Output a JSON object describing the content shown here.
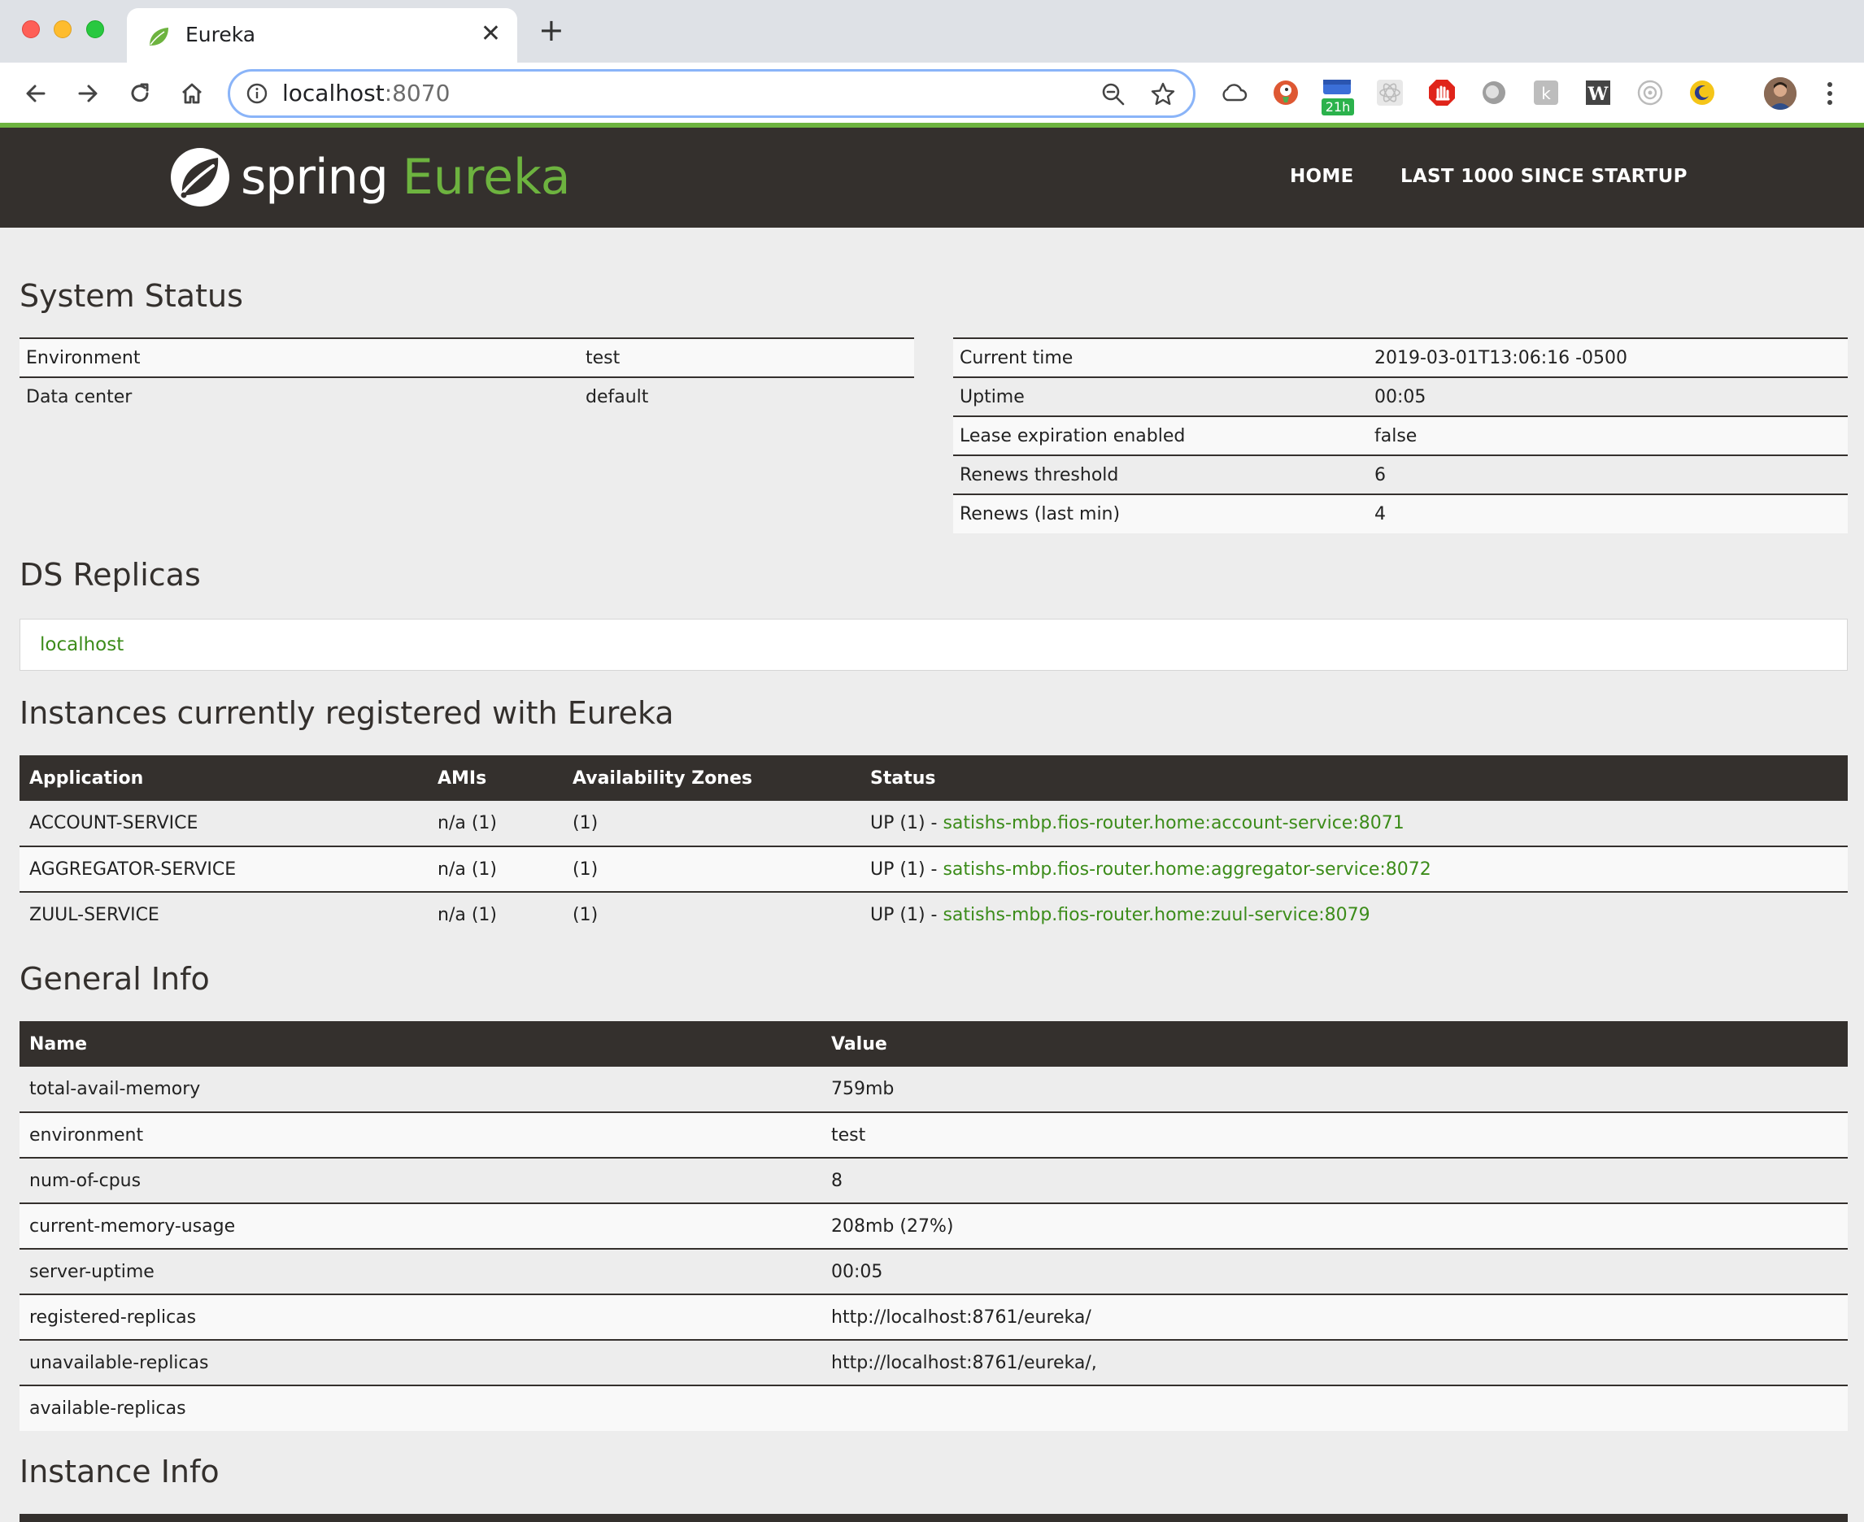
{
  "browser": {
    "tab_title": "Eureka",
    "url_host": "localhost",
    "url_port": ":8070",
    "badge_text": "21h"
  },
  "nav": {
    "logo_spring": "spring",
    "logo_eureka": "Eureka",
    "home": "HOME",
    "last1000": "LAST 1000 SINCE STARTUP"
  },
  "system_status": {
    "heading": "System Status",
    "left": [
      {
        "key": "Environment",
        "value": "test"
      },
      {
        "key": "Data center",
        "value": "default"
      }
    ],
    "right": [
      {
        "key": "Current time",
        "value": "2019-03-01T13:06:16 -0500"
      },
      {
        "key": "Uptime",
        "value": "00:05"
      },
      {
        "key": "Lease expiration enabled",
        "value": "false"
      },
      {
        "key": "Renews threshold",
        "value": "6"
      },
      {
        "key": "Renews (last min)",
        "value": "4"
      }
    ]
  },
  "ds_replicas": {
    "heading": "DS Replicas",
    "link": "localhost"
  },
  "instances": {
    "heading": "Instances currently registered with Eureka",
    "columns": [
      "Application",
      "AMIs",
      "Availability Zones",
      "Status"
    ],
    "rows": [
      {
        "app": "ACCOUNT-SERVICE",
        "amis": "n/a (1)",
        "zones": "(1)",
        "status": "UP (1) - ",
        "link": "satishs-mbp.fios-router.home:account-service:8071"
      },
      {
        "app": "AGGREGATOR-SERVICE",
        "amis": "n/a (1)",
        "zones": "(1)",
        "status": "UP (1) - ",
        "link": "satishs-mbp.fios-router.home:aggregator-service:8072"
      },
      {
        "app": "ZUUL-SERVICE",
        "amis": "n/a (1)",
        "zones": "(1)",
        "status": "UP (1) - ",
        "link": "satishs-mbp.fios-router.home:zuul-service:8079"
      }
    ]
  },
  "general_info": {
    "heading": "General Info",
    "columns": [
      "Name",
      "Value"
    ],
    "rows": [
      {
        "name": "total-avail-memory",
        "value": "759mb"
      },
      {
        "name": "environment",
        "value": "test"
      },
      {
        "name": "num-of-cpus",
        "value": "8"
      },
      {
        "name": "current-memory-usage",
        "value": "208mb (27%)"
      },
      {
        "name": "server-uptime",
        "value": "00:05"
      },
      {
        "name": "registered-replicas",
        "value": "http://localhost:8761/eureka/"
      },
      {
        "name": "unavailable-replicas",
        "value": "http://localhost:8761/eureka/,"
      },
      {
        "name": "available-replicas",
        "value": ""
      }
    ]
  },
  "instance_info": {
    "heading": "Instance Info"
  },
  "colors": {
    "spring_green": "#6db33f",
    "nav_dark": "#34302d",
    "link_green": "#3c8c1a"
  }
}
